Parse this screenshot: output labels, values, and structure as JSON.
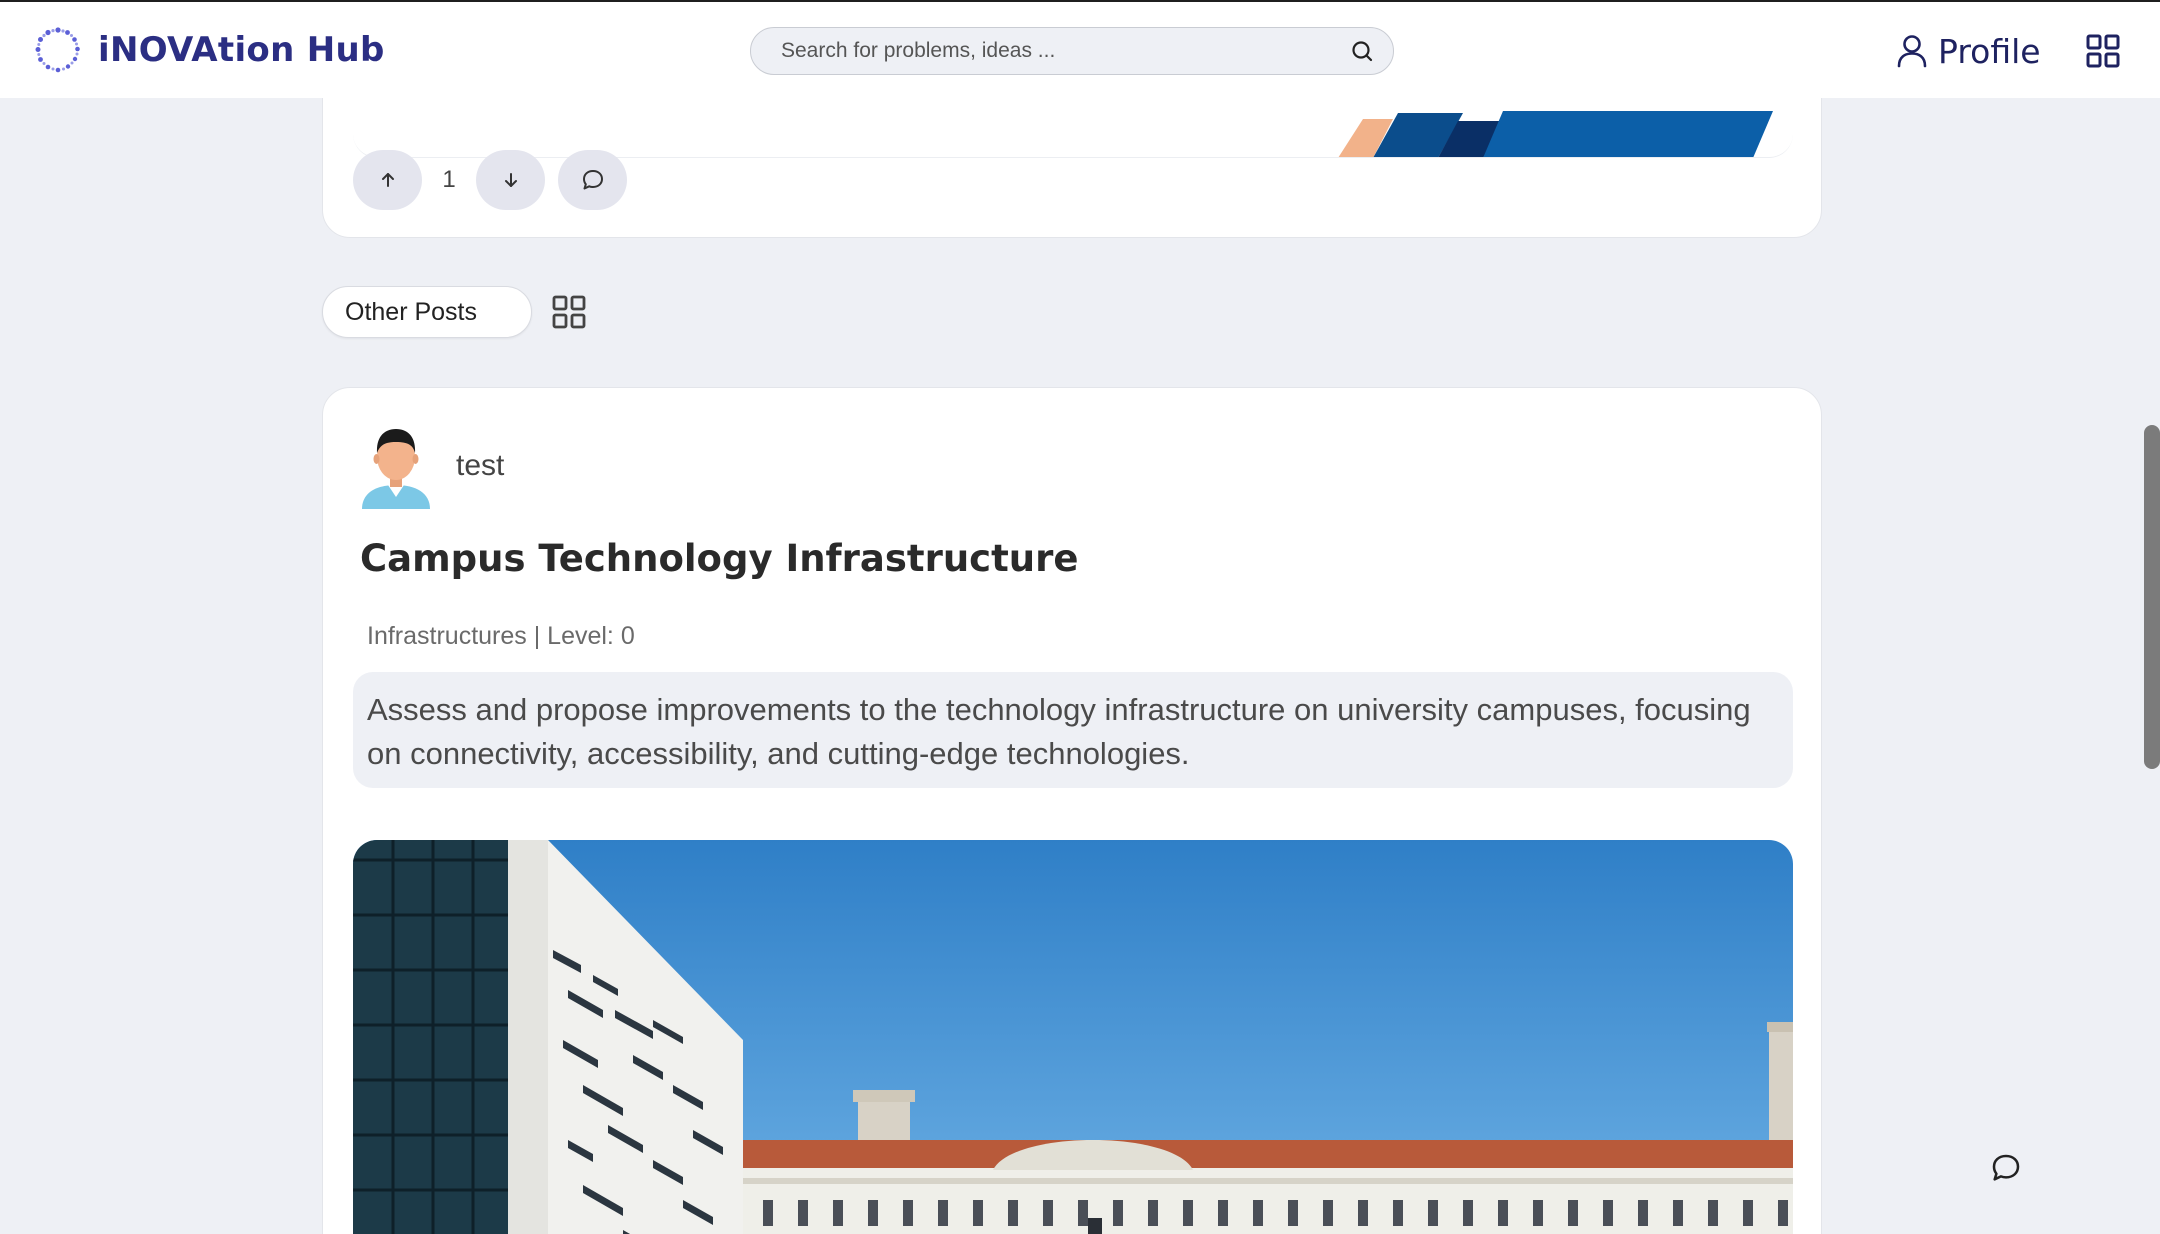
{
  "app": {
    "brand": "iNOVAtion Hub",
    "accent_color": "#2b2e83",
    "icons": [
      "logo-dots-icon",
      "search-icon",
      "user-icon",
      "grid-icon",
      "arrow-up-icon",
      "arrow-down-icon",
      "comment-icon"
    ]
  },
  "navbar": {
    "search_placeholder": "Search for problems, ideas ...",
    "profile_label": "Profile"
  },
  "previous_post": {
    "vote_count": "1"
  },
  "feed": {
    "section_label": "Other Posts"
  },
  "post": {
    "author": "test",
    "title": "Campus Technology Infrastructure",
    "meta": "Infrastructures | Level: 0",
    "description": "Assess and propose improvements to the technology infrastructure on university campuses, focusing on connectivity, accessibility, and cutting-edge technologies."
  }
}
